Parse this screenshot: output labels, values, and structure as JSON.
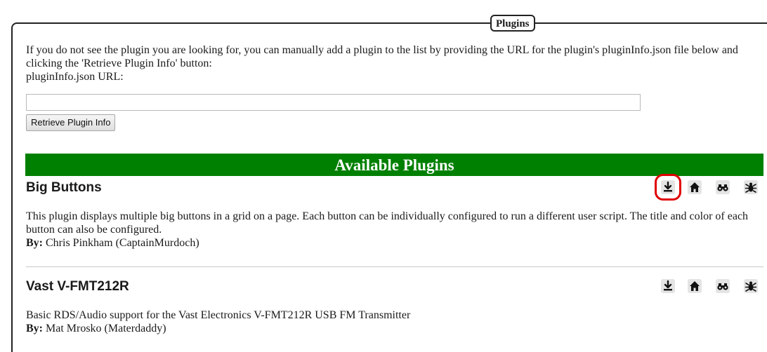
{
  "panel": {
    "legend": "Plugins",
    "intro_text": "If you do not see the plugin you are looking for, you can manually add a plugin to the list by providing the URL for the plugin's pluginInfo.json file below and clicking the 'Retrieve Plugin Info' button:",
    "url_label": "pluginInfo.json URL:",
    "url_value": "",
    "retrieve_button": "Retrieve Plugin Info"
  },
  "available_header": "Available Plugins",
  "plugins": [
    {
      "name": "Big Buttons",
      "description": "This plugin displays multiple big buttons in a grid on a page. Each button can be individually configured to run a different user script. The title and color of each button can also be configured.",
      "by_label": "By:",
      "author": "Chris Pinkham (CaptainMurdoch)",
      "icons": [
        "download-icon",
        "home-icon",
        "binoculars-icon",
        "bug-icon"
      ]
    },
    {
      "name": "Vast V-FMT212R",
      "description": "Basic RDS/Audio support for the Vast Electronics V-FMT212R USB FM Transmitter",
      "by_label": "By:",
      "author": "Mat Mrosko (Materdaddy)",
      "icons": [
        "download-icon",
        "home-icon",
        "binoculars-icon",
        "bug-icon"
      ]
    }
  ],
  "colors": {
    "header_green": "#008000",
    "highlight_red": "#e00000",
    "icon_bg": "#e4e4e4"
  }
}
